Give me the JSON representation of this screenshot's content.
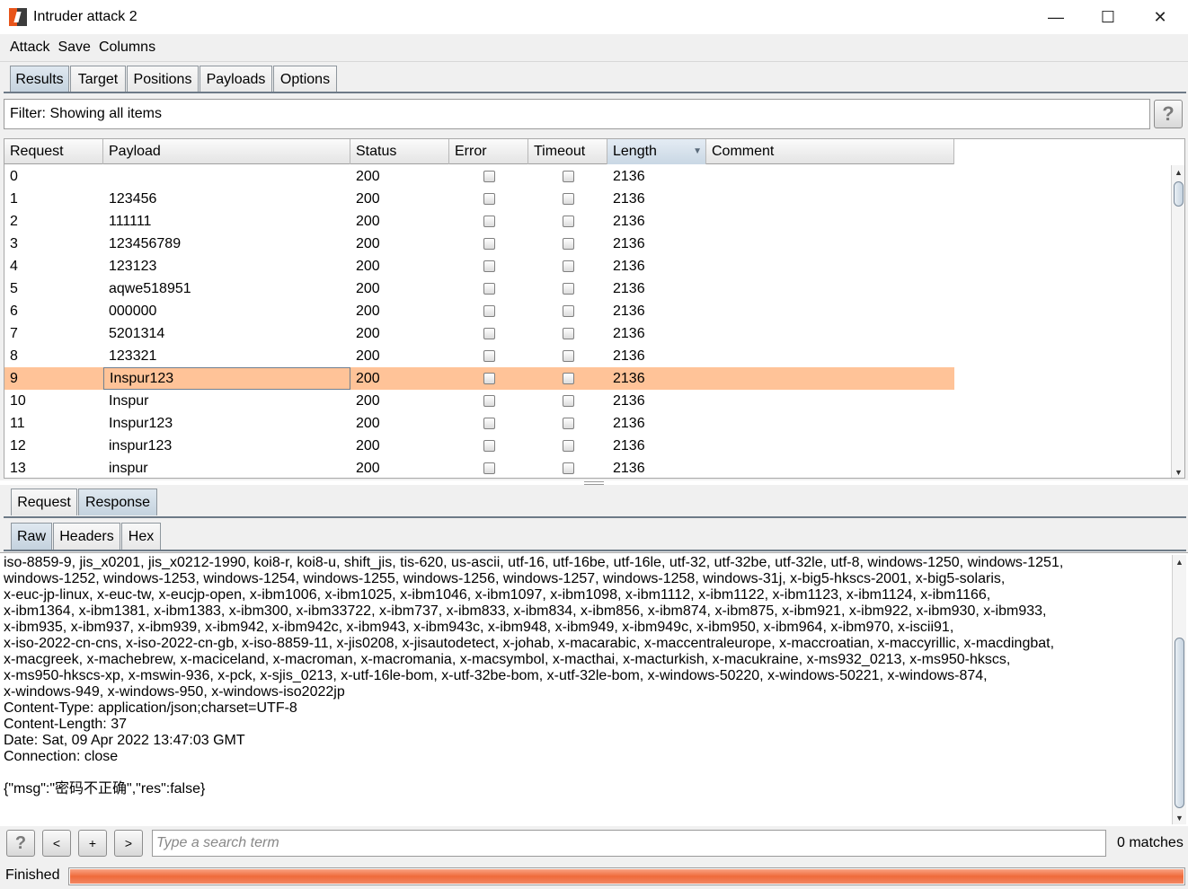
{
  "window": {
    "title": "Intruder attack 2",
    "minimize": "—",
    "maximize": "☐",
    "close": "✕"
  },
  "menu": [
    "Attack",
    "Save",
    "Columns"
  ],
  "main_tabs": [
    "Results",
    "Target",
    "Positions",
    "Payloads",
    "Options"
  ],
  "main_tab_active": "Results",
  "filter": {
    "label": "Filter: Showing all items",
    "help": "?"
  },
  "table": {
    "columns": [
      "Request",
      "Payload",
      "Status",
      "Error",
      "Timeout",
      "Length",
      "Comment"
    ],
    "sorted_column": "Length",
    "rows": [
      {
        "request": "0",
        "payload": "",
        "status": "200",
        "error": false,
        "timeout": false,
        "length": "2136",
        "comment": ""
      },
      {
        "request": "1",
        "payload": "123456",
        "status": "200",
        "error": false,
        "timeout": false,
        "length": "2136",
        "comment": ""
      },
      {
        "request": "2",
        "payload": "111111",
        "status": "200",
        "error": false,
        "timeout": false,
        "length": "2136",
        "comment": ""
      },
      {
        "request": "3",
        "payload": "123456789",
        "status": "200",
        "error": false,
        "timeout": false,
        "length": "2136",
        "comment": ""
      },
      {
        "request": "4",
        "payload": "123123",
        "status": "200",
        "error": false,
        "timeout": false,
        "length": "2136",
        "comment": ""
      },
      {
        "request": "5",
        "payload": "aqwe518951",
        "status": "200",
        "error": false,
        "timeout": false,
        "length": "2136",
        "comment": ""
      },
      {
        "request": "6",
        "payload": "000000",
        "status": "200",
        "error": false,
        "timeout": false,
        "length": "2136",
        "comment": ""
      },
      {
        "request": "7",
        "payload": "5201314",
        "status": "200",
        "error": false,
        "timeout": false,
        "length": "2136",
        "comment": ""
      },
      {
        "request": "8",
        "payload": "123321",
        "status": "200",
        "error": false,
        "timeout": false,
        "length": "2136",
        "comment": ""
      },
      {
        "request": "9",
        "payload": "Inspur123",
        "status": "200",
        "error": false,
        "timeout": false,
        "length": "2136",
        "comment": "",
        "selected": true
      },
      {
        "request": "10",
        "payload": "Inspur",
        "status": "200",
        "error": false,
        "timeout": false,
        "length": "2136",
        "comment": ""
      },
      {
        "request": "11",
        "payload": "Inspur123",
        "status": "200",
        "error": false,
        "timeout": false,
        "length": "2136",
        "comment": ""
      },
      {
        "request": "12",
        "payload": "inspur123",
        "status": "200",
        "error": false,
        "timeout": false,
        "length": "2136",
        "comment": ""
      },
      {
        "request": "13",
        "payload": "inspur",
        "status": "200",
        "error": false,
        "timeout": false,
        "length": "2136",
        "comment": ""
      }
    ]
  },
  "rr_tabs": [
    "Request",
    "Response"
  ],
  "rr_tab_active": "Response",
  "view_tabs": [
    "Raw",
    "Headers",
    "Hex"
  ],
  "view_tab_active": "Raw",
  "response_lines": [
    "iso-8859-9, jis_x0201, jis_x0212-1990, koi8-r, koi8-u, shift_jis, tis-620, us-ascii, utf-16, utf-16be, utf-16le, utf-32, utf-32be, utf-32le, utf-8, windows-1250, windows-1251,",
    "windows-1252, windows-1253, windows-1254, windows-1255, windows-1256, windows-1257, windows-1258, windows-31j, x-big5-hkscs-2001, x-big5-solaris,",
    "x-euc-jp-linux, x-euc-tw, x-eucjp-open, x-ibm1006, x-ibm1025, x-ibm1046, x-ibm1097, x-ibm1098, x-ibm1112, x-ibm1122, x-ibm1123, x-ibm1124, x-ibm1166,",
    "x-ibm1364, x-ibm1381, x-ibm1383, x-ibm300, x-ibm33722, x-ibm737, x-ibm833, x-ibm834, x-ibm856, x-ibm874, x-ibm875, x-ibm921, x-ibm922, x-ibm930, x-ibm933,",
    "x-ibm935, x-ibm937, x-ibm939, x-ibm942, x-ibm942c, x-ibm943, x-ibm943c, x-ibm948, x-ibm949, x-ibm949c, x-ibm950, x-ibm964, x-ibm970, x-iscii91,",
    "x-iso-2022-cn-cns, x-iso-2022-cn-gb, x-iso-8859-11, x-jis0208, x-jisautodetect, x-johab, x-macarabic, x-maccentraleurope, x-maccroatian, x-maccyrillic, x-macdingbat,",
    "x-macgreek, x-machebrew, x-maciceland, x-macroman, x-macromania, x-macsymbol, x-macthai, x-macturkish, x-macukraine, x-ms932_0213, x-ms950-hkscs,",
    "x-ms950-hkscs-xp, x-mswin-936, x-pck, x-sjis_0213, x-utf-16le-bom, x-utf-32be-bom, x-utf-32le-bom, x-windows-50220, x-windows-50221, x-windows-874,",
    "x-windows-949, x-windows-950, x-windows-iso2022jp",
    "Content-Type: application/json;charset=UTF-8",
    "Content-Length: 37",
    "Date: Sat, 09 Apr 2022 13:47:03 GMT",
    "Connection: close",
    "",
    "{\"msg\":\"密码不正确\",\"res\":false}"
  ],
  "search": {
    "help": "?",
    "prev": "<",
    "add": "+",
    "next": ">",
    "placeholder": "Type a search term",
    "matches": "0 matches"
  },
  "status": {
    "text": "Finished",
    "progress": 1.0
  },
  "colors": {
    "selected_row": "#ffc398",
    "progress": "#ef6a3a",
    "tab_active": "#c4d2de"
  }
}
